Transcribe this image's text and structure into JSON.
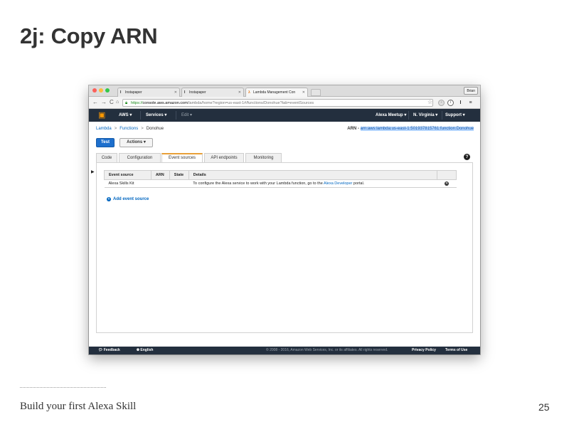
{
  "slide": {
    "title": "2j: Copy ARN",
    "footer_text": "Build your first Alexa Skill",
    "page_number": "25"
  },
  "browser": {
    "tabs": [
      {
        "label": "Instapaper",
        "favicon": "I",
        "active": false
      },
      {
        "label": "Instapaper",
        "favicon": "I",
        "active": false
      },
      {
        "label": "Lambda Management Con",
        "favicon": "lambda-icon",
        "active": true
      }
    ],
    "user_button": "Brian",
    "url": {
      "scheme": "https://",
      "domain": "console.aws.amazon.com",
      "path": "/lambda/home?region=us-east-1#/functions/Donohue?tab=eventSources"
    },
    "colors": {
      "close": "#fc605b",
      "minimize": "#fdbc40",
      "maximize": "#34c84a"
    }
  },
  "aws_nav": {
    "aws_label": "AWS ▾",
    "services_label": "Services ▾",
    "edit_label": "Edit ▾",
    "account_label": "Alexa Meetup ▾",
    "region_label": "N. Virginia ▾",
    "support_label": "Support ▾",
    "brand_color": "#ff9900"
  },
  "breadcrumb": {
    "items": [
      "Lambda",
      "Functions",
      "Donohue"
    ],
    "separator": ">"
  },
  "arn": {
    "label": "ARN -",
    "value": "arn:aws:lambda:us-east-1:501937815761:function:Donohue"
  },
  "buttons": {
    "test": "Test",
    "actions": "Actions ▾"
  },
  "tabs": [
    "Code",
    "Configuration",
    "Event sources",
    "API endpoints",
    "Monitoring"
  ],
  "active_tab": "Event sources",
  "event_table": {
    "headers": [
      "Event source",
      "ARN",
      "State",
      "Details"
    ],
    "rows": [
      {
        "event_source": "Alexa Skills Kit",
        "arn": "",
        "state": "",
        "details_pre": "To configure the Alexa service to work with your Lambda function, go to the",
        "details_link": "Alexa Developer",
        "details_post": "portal."
      }
    ]
  },
  "add_event_source": "Add event source",
  "footer": {
    "feedback": "Feedback",
    "language": "English",
    "copyright": "© 2008 - 2016, Amazon Web Services, Inc. or its affiliates. All rights reserved.",
    "privacy": "Privacy Policy",
    "terms": "Terms of Use"
  }
}
